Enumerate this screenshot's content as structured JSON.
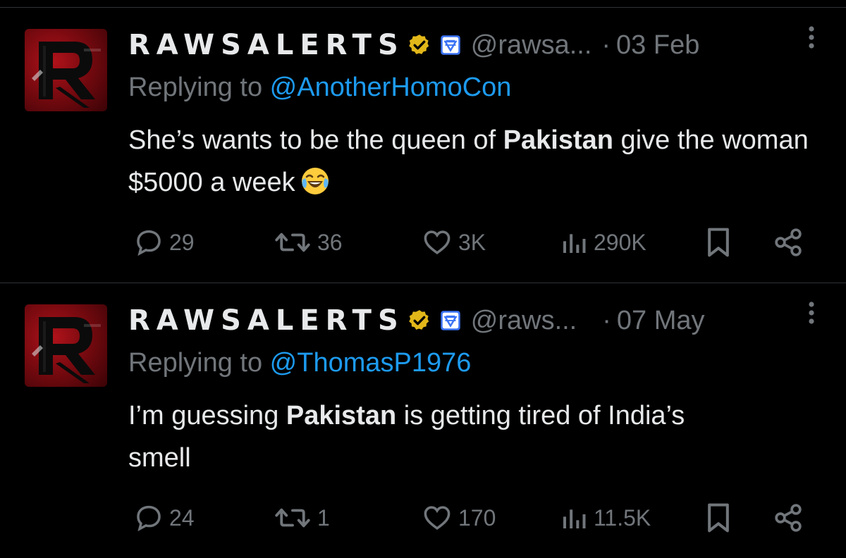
{
  "tweets": [
    {
      "display_name": "RAWSALERTS",
      "handle": "@rawsa...",
      "separator": "·",
      "date": "03 Feb",
      "replying_prefix": "Replying to ",
      "replying_to": "@AnotherHomoCon",
      "text_part1": "She’s wants to be the queen of ",
      "text_bold": "Pakistan",
      "text_part2": " give the woman $5000 a week",
      "emoji": "face-with-tears-of-joy",
      "replies": "29",
      "retweets": "36",
      "likes": "3K",
      "views": "290K"
    },
    {
      "display_name": "RAWSALERTS",
      "handle": "@raws...",
      "separator": "·",
      "date": "07 May",
      "replying_prefix": "Replying to ",
      "replying_to": "@ThomasP1976",
      "text_part1": "I’m guessing ",
      "text_bold": "Pakistan",
      "text_part2": " is getting tired of India’s smell",
      "replies": "24",
      "retweets": "1",
      "likes": "170",
      "views": "11.5K"
    }
  ],
  "colors": {
    "background": "#000000",
    "primary_text": "#e7e9ea",
    "secondary_text": "#71767b",
    "link": "#1d9bf0",
    "divider": "#2f3336",
    "verified_badge": "#e2b719",
    "affiliate_badge": "#3b73f5"
  },
  "icons": {
    "verified": "gold-verified-badge-icon",
    "affiliate": "affiliate-badge-icon",
    "more": "more-vertical-icon",
    "reply": "reply-bubble-icon",
    "retweet": "retweet-icon",
    "like": "heart-icon",
    "views": "views-chart-icon",
    "bookmark": "bookmark-icon",
    "share": "share-icon"
  }
}
